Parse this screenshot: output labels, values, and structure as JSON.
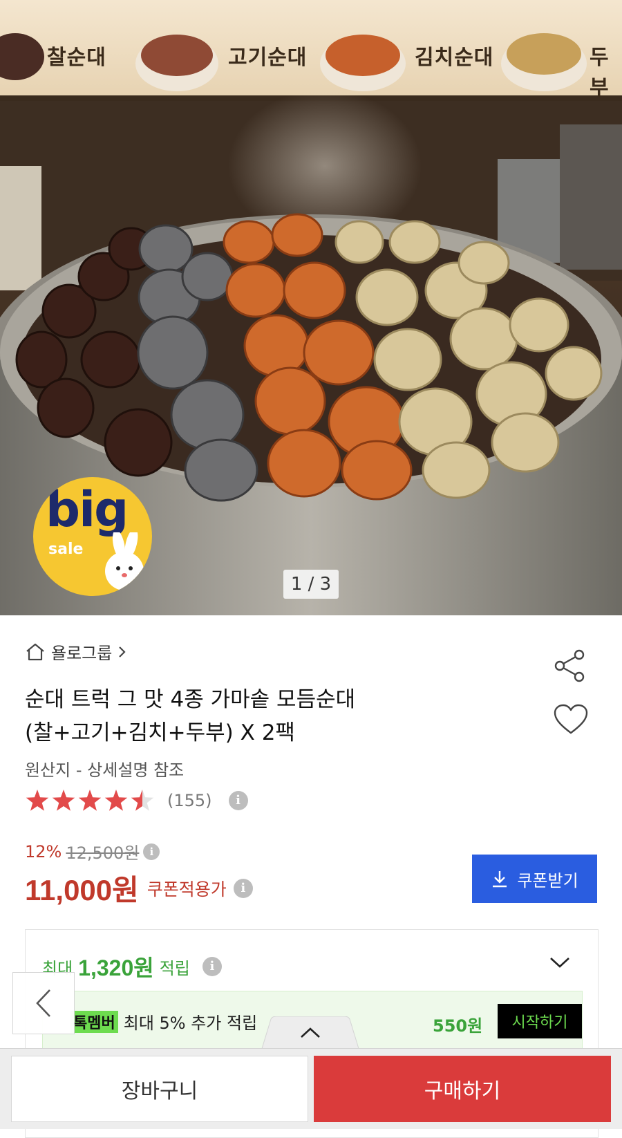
{
  "hero": {
    "sign_labels": [
      "찰순대",
      "고기순대",
      "김치순대",
      "두부"
    ],
    "badge_big": "big",
    "badge_sale": "sale",
    "counter": "1 / 3"
  },
  "store": {
    "name": "욜로그룹"
  },
  "product": {
    "title_line1": "순대 트럭 그 맛 4종 가마솥 모듬순대",
    "title_line2": "(찰+고기+김치+두부) X 2팩",
    "origin": "원산지 - 상세설명 참조",
    "rating_value": 4.5,
    "review_count": "(155)"
  },
  "pricing": {
    "discount_pct": "12%",
    "original_price": "12,500원",
    "sale_price": "11,000원",
    "price_label": "쿠폰적용가",
    "coupon_button": "쿠폰받기"
  },
  "points": {
    "prefix": "최대",
    "amount": "1,320원",
    "suffix": "적립",
    "member_badge_a": "톡",
    "member_badge_b": "멤버",
    "member_text": "최대 5% 추가 적립",
    "member_amount": "550원",
    "start_button": "시작하기"
  },
  "actions": {
    "cart": "장바구니",
    "buy": "구매하기"
  },
  "colors": {
    "accent_red": "#da3b3b",
    "coupon_blue": "#2a5de0",
    "points_green": "#3aa33a"
  }
}
